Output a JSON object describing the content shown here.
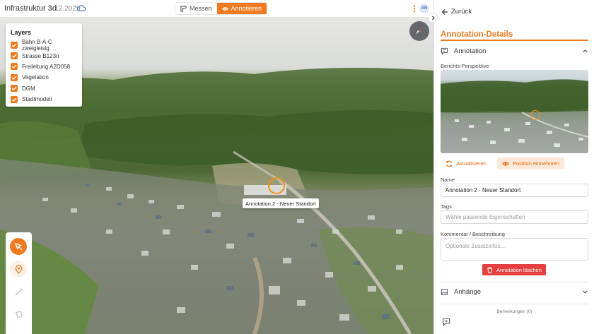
{
  "topbar": {
    "title": "Infrastruktur 3d",
    "date": "1.12.2025",
    "measure_label": "Messen",
    "annotate_label": "Annotieren",
    "avatar_initials": "AN"
  },
  "layers": {
    "title": "Layers",
    "items": [
      {
        "label": "Bahn B-A-C zweigleisig",
        "checked": true
      },
      {
        "label": "Strasse B123n",
        "checked": true
      },
      {
        "label": "Freileitung A2D058",
        "checked": true
      },
      {
        "label": "Vegetation",
        "checked": true
      },
      {
        "label": "DGM",
        "checked": true
      },
      {
        "label": "Stadtmodell",
        "checked": true
      }
    ]
  },
  "map": {
    "annotation_label": "Annotation 2 - Neuer Standort",
    "tools": [
      "annotate-tool-icon",
      "location-pin-icon",
      "line-tool-icon",
      "area-tool-icon"
    ]
  },
  "panel": {
    "back_label": "Zurück",
    "title": "Annotation-Details",
    "annotation_section": "Annotation",
    "perspective_label": "Berichts-Perspektive",
    "update_label": "Aktualisieren",
    "take_position_label": "Position einnehmen",
    "name_label": "Name",
    "name_value": "Annotation 2 - Neuer Standort",
    "tags_label": "Tags",
    "tags_placeholder": "Wähle passende Eigenschaften",
    "comment_label": "Kommentar / Beschreibung",
    "comment_placeholder": "Optionale Zusatzinfos...",
    "delete_label": "Annotation löschen",
    "attachments_label": "Anhänge",
    "remarks_label": "Bemerkungen (0)"
  },
  "colors": {
    "accent": "#f07a1e",
    "danger": "#e53f3f",
    "marker": "#f29216"
  }
}
